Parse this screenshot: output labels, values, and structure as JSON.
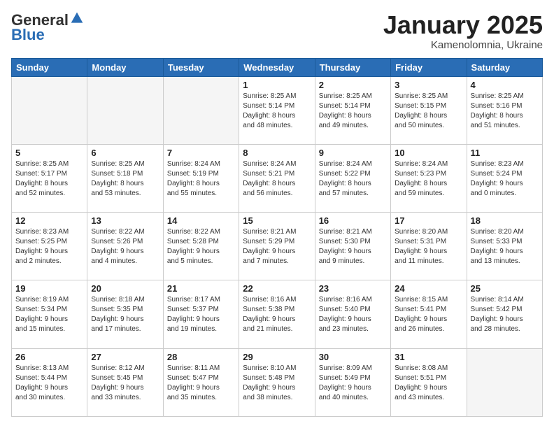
{
  "header": {
    "logo_line1": "General",
    "logo_line2": "Blue",
    "month": "January 2025",
    "location": "Kamenolomnia, Ukraine"
  },
  "weekdays": [
    "Sunday",
    "Monday",
    "Tuesday",
    "Wednesday",
    "Thursday",
    "Friday",
    "Saturday"
  ],
  "weeks": [
    [
      {
        "day": "",
        "info": ""
      },
      {
        "day": "",
        "info": ""
      },
      {
        "day": "",
        "info": ""
      },
      {
        "day": "1",
        "info": "Sunrise: 8:25 AM\nSunset: 5:14 PM\nDaylight: 8 hours\nand 48 minutes."
      },
      {
        "day": "2",
        "info": "Sunrise: 8:25 AM\nSunset: 5:14 PM\nDaylight: 8 hours\nand 49 minutes."
      },
      {
        "day": "3",
        "info": "Sunrise: 8:25 AM\nSunset: 5:15 PM\nDaylight: 8 hours\nand 50 minutes."
      },
      {
        "day": "4",
        "info": "Sunrise: 8:25 AM\nSunset: 5:16 PM\nDaylight: 8 hours\nand 51 minutes."
      }
    ],
    [
      {
        "day": "5",
        "info": "Sunrise: 8:25 AM\nSunset: 5:17 PM\nDaylight: 8 hours\nand 52 minutes."
      },
      {
        "day": "6",
        "info": "Sunrise: 8:25 AM\nSunset: 5:18 PM\nDaylight: 8 hours\nand 53 minutes."
      },
      {
        "day": "7",
        "info": "Sunrise: 8:24 AM\nSunset: 5:19 PM\nDaylight: 8 hours\nand 55 minutes."
      },
      {
        "day": "8",
        "info": "Sunrise: 8:24 AM\nSunset: 5:21 PM\nDaylight: 8 hours\nand 56 minutes."
      },
      {
        "day": "9",
        "info": "Sunrise: 8:24 AM\nSunset: 5:22 PM\nDaylight: 8 hours\nand 57 minutes."
      },
      {
        "day": "10",
        "info": "Sunrise: 8:24 AM\nSunset: 5:23 PM\nDaylight: 8 hours\nand 59 minutes."
      },
      {
        "day": "11",
        "info": "Sunrise: 8:23 AM\nSunset: 5:24 PM\nDaylight: 9 hours\nand 0 minutes."
      }
    ],
    [
      {
        "day": "12",
        "info": "Sunrise: 8:23 AM\nSunset: 5:25 PM\nDaylight: 9 hours\nand 2 minutes."
      },
      {
        "day": "13",
        "info": "Sunrise: 8:22 AM\nSunset: 5:26 PM\nDaylight: 9 hours\nand 4 minutes."
      },
      {
        "day": "14",
        "info": "Sunrise: 8:22 AM\nSunset: 5:28 PM\nDaylight: 9 hours\nand 5 minutes."
      },
      {
        "day": "15",
        "info": "Sunrise: 8:21 AM\nSunset: 5:29 PM\nDaylight: 9 hours\nand 7 minutes."
      },
      {
        "day": "16",
        "info": "Sunrise: 8:21 AM\nSunset: 5:30 PM\nDaylight: 9 hours\nand 9 minutes."
      },
      {
        "day": "17",
        "info": "Sunrise: 8:20 AM\nSunset: 5:31 PM\nDaylight: 9 hours\nand 11 minutes."
      },
      {
        "day": "18",
        "info": "Sunrise: 8:20 AM\nSunset: 5:33 PM\nDaylight: 9 hours\nand 13 minutes."
      }
    ],
    [
      {
        "day": "19",
        "info": "Sunrise: 8:19 AM\nSunset: 5:34 PM\nDaylight: 9 hours\nand 15 minutes."
      },
      {
        "day": "20",
        "info": "Sunrise: 8:18 AM\nSunset: 5:35 PM\nDaylight: 9 hours\nand 17 minutes."
      },
      {
        "day": "21",
        "info": "Sunrise: 8:17 AM\nSunset: 5:37 PM\nDaylight: 9 hours\nand 19 minutes."
      },
      {
        "day": "22",
        "info": "Sunrise: 8:16 AM\nSunset: 5:38 PM\nDaylight: 9 hours\nand 21 minutes."
      },
      {
        "day": "23",
        "info": "Sunrise: 8:16 AM\nSunset: 5:40 PM\nDaylight: 9 hours\nand 23 minutes."
      },
      {
        "day": "24",
        "info": "Sunrise: 8:15 AM\nSunset: 5:41 PM\nDaylight: 9 hours\nand 26 minutes."
      },
      {
        "day": "25",
        "info": "Sunrise: 8:14 AM\nSunset: 5:42 PM\nDaylight: 9 hours\nand 28 minutes."
      }
    ],
    [
      {
        "day": "26",
        "info": "Sunrise: 8:13 AM\nSunset: 5:44 PM\nDaylight: 9 hours\nand 30 minutes."
      },
      {
        "day": "27",
        "info": "Sunrise: 8:12 AM\nSunset: 5:45 PM\nDaylight: 9 hours\nand 33 minutes."
      },
      {
        "day": "28",
        "info": "Sunrise: 8:11 AM\nSunset: 5:47 PM\nDaylight: 9 hours\nand 35 minutes."
      },
      {
        "day": "29",
        "info": "Sunrise: 8:10 AM\nSunset: 5:48 PM\nDaylight: 9 hours\nand 38 minutes."
      },
      {
        "day": "30",
        "info": "Sunrise: 8:09 AM\nSunset: 5:49 PM\nDaylight: 9 hours\nand 40 minutes."
      },
      {
        "day": "31",
        "info": "Sunrise: 8:08 AM\nSunset: 5:51 PM\nDaylight: 9 hours\nand 43 minutes."
      },
      {
        "day": "",
        "info": ""
      }
    ]
  ]
}
